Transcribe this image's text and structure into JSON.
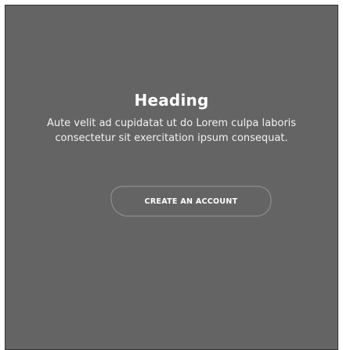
{
  "hero": {
    "heading": "Heading",
    "body": "Aute velit ad cupidatat ut do Lorem culpa laboris consectetur sit exercitation ipsum consequat.",
    "cta_label": "CREATE AN ACCOUNT"
  },
  "colors": {
    "panel_background": "#646464",
    "text": "#ffffff",
    "button_outline": "#8a8a8a"
  }
}
